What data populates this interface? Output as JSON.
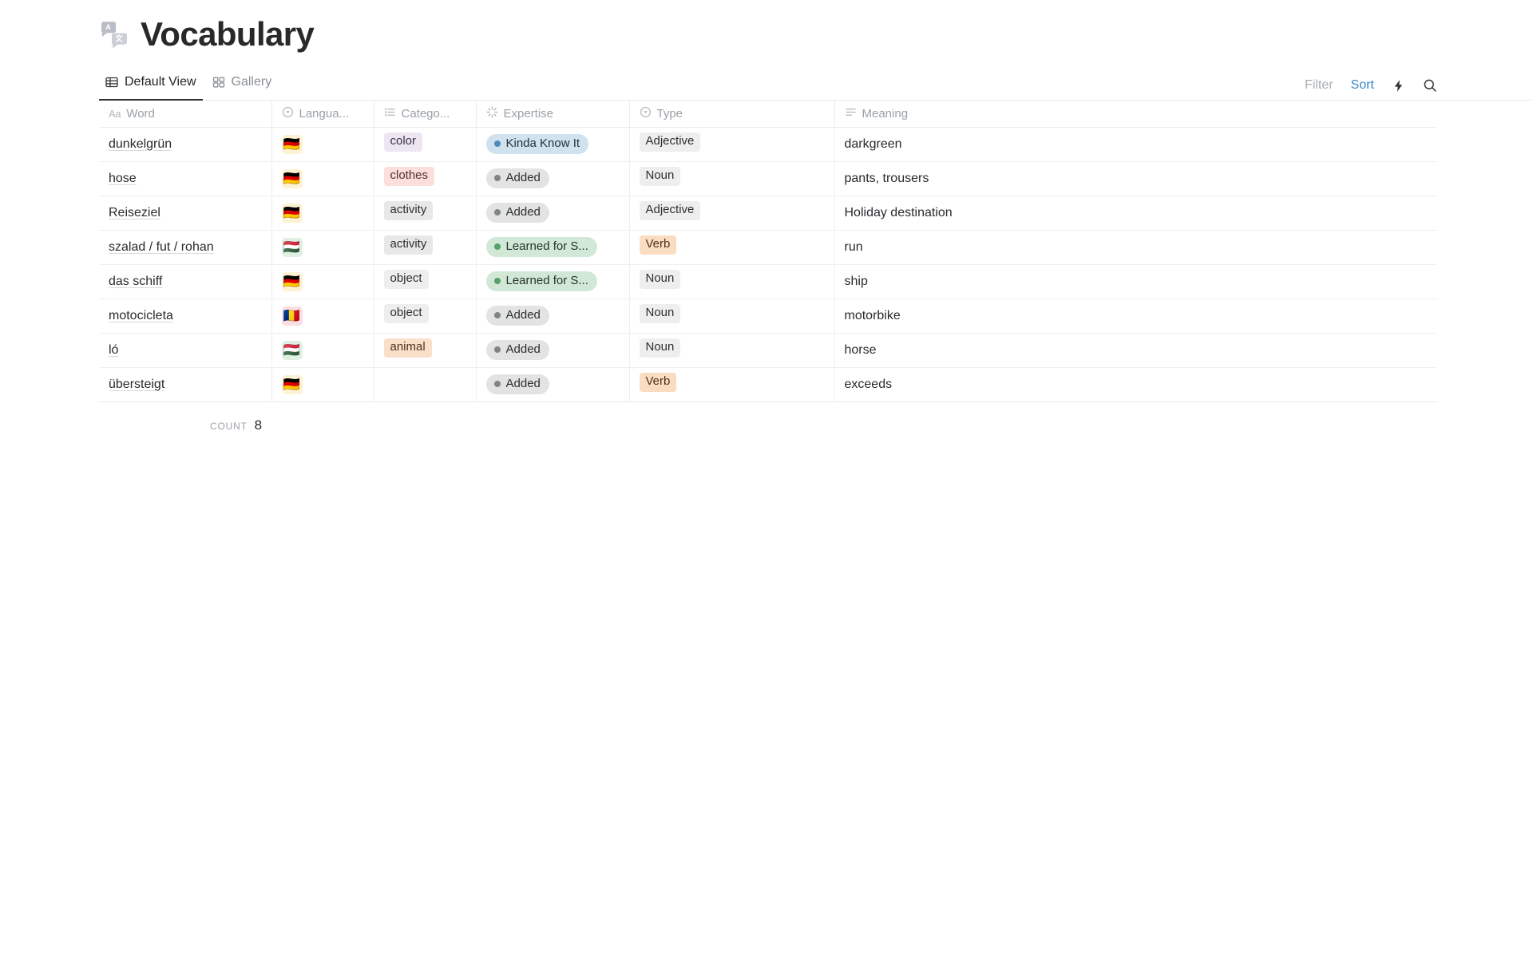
{
  "header": {
    "title": "Vocabulary",
    "title_icon": "translate-icon"
  },
  "tabs": [
    {
      "label": "Default View",
      "icon": "table-grid-icon",
      "active": true
    },
    {
      "label": "Gallery",
      "icon": "gallery-grid-icon",
      "active": false
    }
  ],
  "view_actions": {
    "filter_label": "Filter",
    "sort_label": "Sort",
    "automation_icon": "lightning-bolt-icon",
    "search_icon": "search-icon",
    "sort_accent_color": "#3b87c9",
    "filter_color": "#a6abb0"
  },
  "table": {
    "columns": [
      {
        "key": "word",
        "label": "Word",
        "icon": "text-aa-icon"
      },
      {
        "key": "language",
        "label": "Langua...",
        "icon": "select-circle-icon"
      },
      {
        "key": "category",
        "label": "Catego...",
        "icon": "multi-select-list-icon"
      },
      {
        "key": "expertise",
        "label": "Expertise",
        "icon": "status-spinner-icon"
      },
      {
        "key": "type",
        "label": "Type",
        "icon": "select-circle-icon"
      },
      {
        "key": "meaning",
        "label": "Meaning",
        "icon": "text-lines-icon"
      }
    ],
    "rows": [
      {
        "word": "dunkelgrün",
        "language": {
          "flag": "🇩🇪",
          "name": "german-flag",
          "chip_bg": "#fdf2d3"
        },
        "category": {
          "text": "color",
          "bg": "#ece5f2",
          "fg": "#403149"
        },
        "expertise": {
          "text": "Kinda Know It",
          "bg": "#cfe2ee",
          "dot": "#4f8db8",
          "fg": "#22333f"
        },
        "type": {
          "text": "Adjective",
          "bg": "#eeeeee",
          "fg": "#2b2e31"
        },
        "meaning": "darkgreen"
      },
      {
        "word": "hose",
        "language": {
          "flag": "🇩🇪",
          "name": "german-flag",
          "chip_bg": "#fdf2d3"
        },
        "category": {
          "text": "clothes",
          "bg": "#fbdfdd",
          "fg": "#55302d"
        },
        "expertise": {
          "text": "Added",
          "bg": "#e3e3e3",
          "dot": "#7f8487",
          "fg": "#2b2e31"
        },
        "type": {
          "text": "Noun",
          "bg": "#eeeeee",
          "fg": "#2b2e31"
        },
        "meaning": "pants, trousers"
      },
      {
        "word": "Reiseziel",
        "language": {
          "flag": "🇩🇪",
          "name": "german-flag",
          "chip_bg": "#fdf2d3"
        },
        "category": {
          "text": "activity",
          "bg": "#e8e8e8",
          "fg": "#2b2e31"
        },
        "expertise": {
          "text": "Added",
          "bg": "#e3e3e3",
          "dot": "#7f8487",
          "fg": "#2b2e31"
        },
        "type": {
          "text": "Adjective",
          "bg": "#eeeeee",
          "fg": "#2b2e31"
        },
        "meaning": "Holiday destination"
      },
      {
        "word": "szalad / fut / rohan",
        "language": {
          "flag": "🇭🇺",
          "name": "hungarian-flag",
          "chip_bg": "#dff0e2"
        },
        "category": {
          "text": "activity",
          "bg": "#e8e8e8",
          "fg": "#2b2e31"
        },
        "expertise": {
          "text": "Learned for S...",
          "bg": "#d2e8d6",
          "dot": "#57a06a",
          "fg": "#25332a"
        },
        "type": {
          "text": "Verb",
          "bg": "#fadcc1",
          "fg": "#4a331d"
        },
        "meaning": "run"
      },
      {
        "word": "das schiff",
        "language": {
          "flag": "🇩🇪",
          "name": "german-flag",
          "chip_bg": "#fdf2d3"
        },
        "category": {
          "text": "object",
          "bg": "#eeeeee",
          "fg": "#2b2e31"
        },
        "expertise": {
          "text": "Learned for S...",
          "bg": "#d2e8d6",
          "dot": "#57a06a",
          "fg": "#25332a"
        },
        "type": {
          "text": "Noun",
          "bg": "#eeeeee",
          "fg": "#2b2e31"
        },
        "meaning": "ship"
      },
      {
        "word": "motocicleta",
        "language": {
          "flag": "🇷🇴",
          "name": "romanian-flag",
          "chip_bg": "#fbdde2"
        },
        "category": {
          "text": "object",
          "bg": "#eeeeee",
          "fg": "#2b2e31"
        },
        "expertise": {
          "text": "Added",
          "bg": "#e3e3e3",
          "dot": "#7f8487",
          "fg": "#2b2e31"
        },
        "type": {
          "text": "Noun",
          "bg": "#eeeeee",
          "fg": "#2b2e31"
        },
        "meaning": "motorbike"
      },
      {
        "word": "ló",
        "language": {
          "flag": "🇭🇺",
          "name": "hungarian-flag",
          "chip_bg": "#dff0e2"
        },
        "category": {
          "text": "animal",
          "bg": "#fadfc9",
          "fg": "#4a331d"
        },
        "expertise": {
          "text": "Added",
          "bg": "#e3e3e3",
          "dot": "#7f8487",
          "fg": "#2b2e31"
        },
        "type": {
          "text": "Noun",
          "bg": "#eeeeee",
          "fg": "#2b2e31"
        },
        "meaning": "horse"
      },
      {
        "word": "übersteigt",
        "language": {
          "flag": "🇩🇪",
          "name": "german-flag",
          "chip_bg": "#fdf2d3"
        },
        "category": {
          "text": "",
          "bg": "transparent",
          "fg": "#2b2e31"
        },
        "expertise": {
          "text": "Added",
          "bg": "#e3e3e3",
          "dot": "#7f8487",
          "fg": "#2b2e31"
        },
        "type": {
          "text": "Verb",
          "bg": "#fadcc1",
          "fg": "#4a331d"
        },
        "meaning": "exceeds"
      }
    ]
  },
  "footer": {
    "count_label": "COUNT",
    "count_value": "8"
  }
}
